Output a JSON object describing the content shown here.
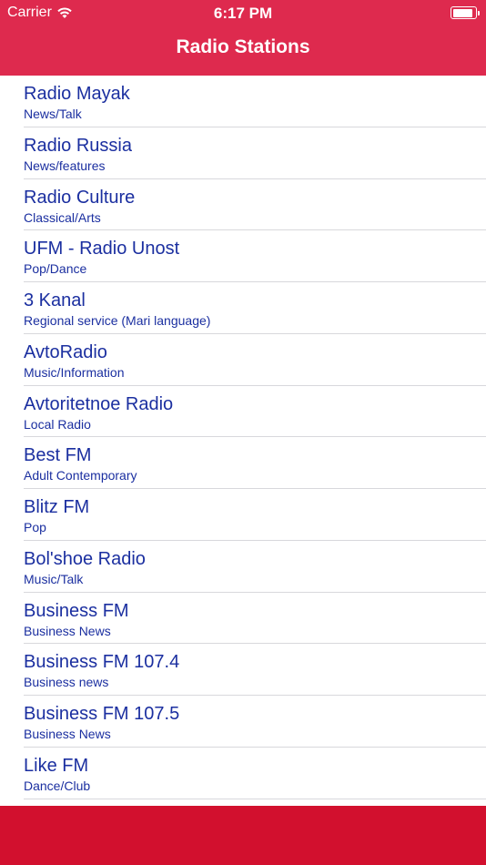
{
  "status_bar": {
    "carrier": "Carrier",
    "time": "6:17 PM",
    "wifi_icon": "wifi-icon",
    "battery_icon": "battery-icon"
  },
  "nav": {
    "title": "Radio Stations",
    "background_color": "#de2a4e"
  },
  "stations": [
    {
      "name": "Radio Mayak",
      "genre": "News/Talk"
    },
    {
      "name": "Radio Russia",
      "genre": "News/features"
    },
    {
      "name": "Radio Culture",
      "genre": "Classical/Arts"
    },
    {
      "name": "UFM - Radio Unost",
      "genre": "Pop/Dance"
    },
    {
      "name": "3 Kanal",
      "genre": "Regional service (Mari language)"
    },
    {
      "name": "AvtoRadio",
      "genre": "Music/Information"
    },
    {
      "name": "Avtoritetnoe Radio",
      "genre": "Local Radio"
    },
    {
      "name": "Best FM",
      "genre": "Adult Contemporary"
    },
    {
      "name": "Blitz FM",
      "genre": "Pop"
    },
    {
      "name": "Bol'shoe Radio",
      "genre": "Music/Talk"
    },
    {
      "name": "Business FM",
      "genre": "Business News"
    },
    {
      "name": "Business FM 107.4",
      "genre": "Business news"
    },
    {
      "name": "Business FM 107.5",
      "genre": "Business News"
    },
    {
      "name": "Like FM",
      "genre": "Dance/Club"
    }
  ],
  "colors": {
    "header": "#de2a4e",
    "footer": "#d2102e",
    "list_text": "#1b2fa0"
  }
}
